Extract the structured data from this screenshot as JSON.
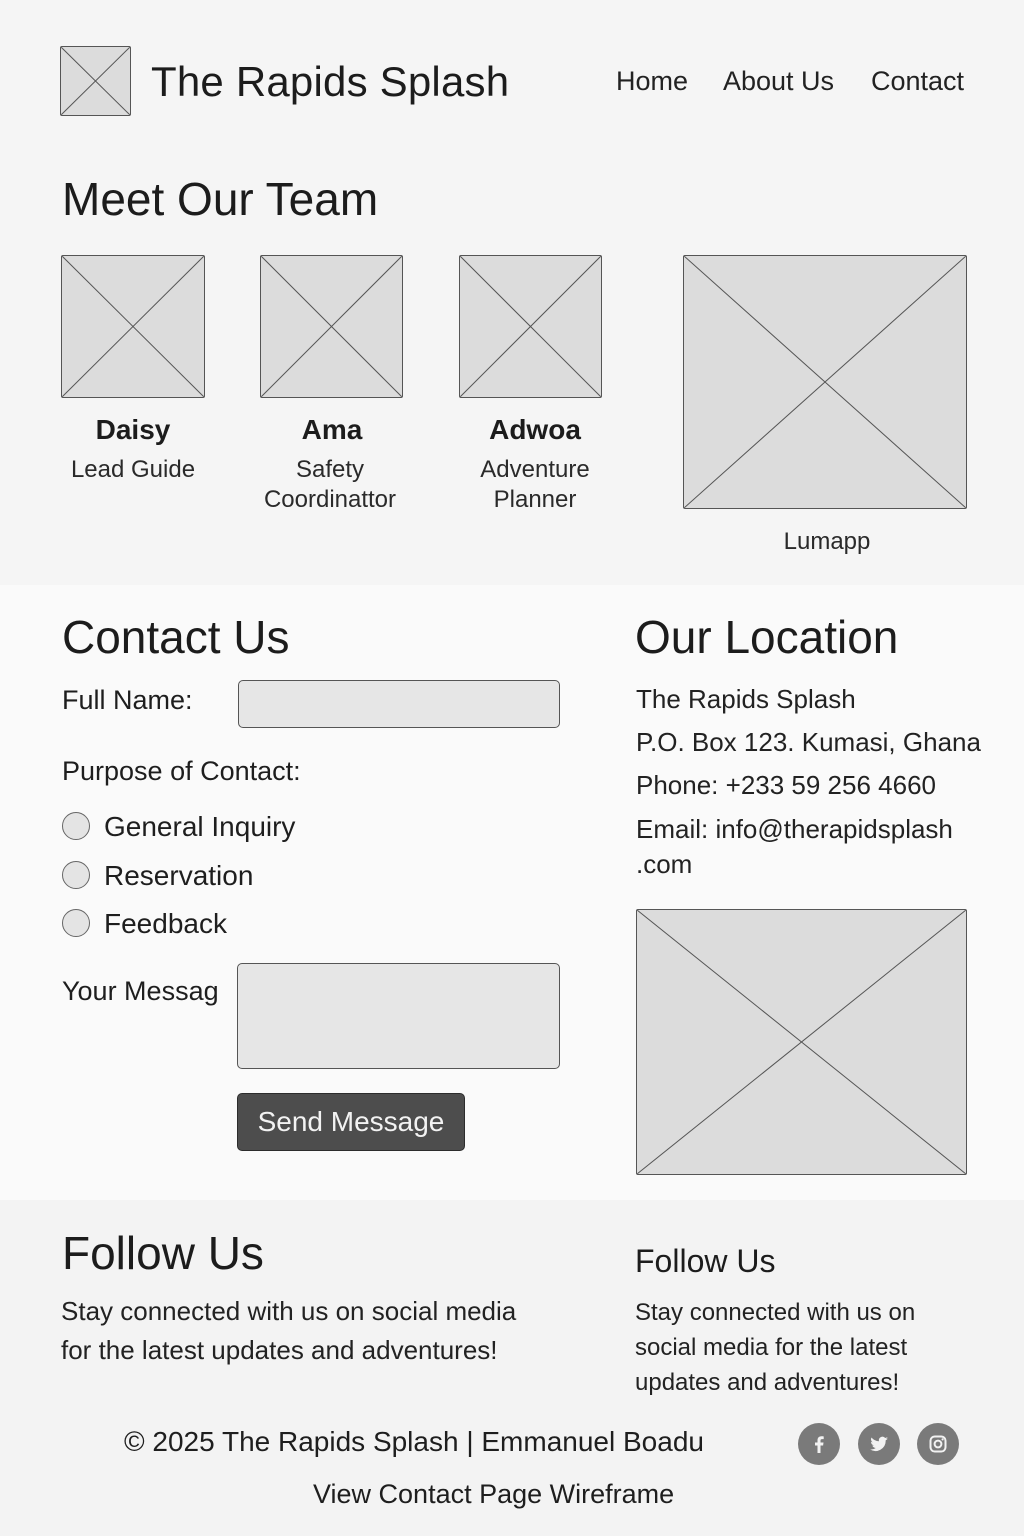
{
  "header": {
    "brand": "The Rapids Splash",
    "nav": [
      "Home",
      "About Us",
      "Contact"
    ]
  },
  "team": {
    "heading": "Meet Our Team",
    "members": [
      {
        "name": "Daisy",
        "role_line1": "Lead Guide",
        "role_line2": ""
      },
      {
        "name": "Ama",
        "role_line1": "Safety",
        "role_line2": "Coordinattor"
      },
      {
        "name": "Adwoa",
        "role_line1": "Adventure",
        "role_line2": "Planner"
      }
    ],
    "feature_caption": "Lumapp"
  },
  "contact": {
    "heading": "Contact Us",
    "full_name_label": "Full Name:",
    "purpose_label": "Purpose of Contact:",
    "options": [
      "General Inquiry",
      "Reservation",
      "Feedback"
    ],
    "message_label": "Your Messag",
    "send_label": "Send Message"
  },
  "location": {
    "heading": "Our Location",
    "lines": [
      "The Rapids Splash",
      "P.O. Box 123. Kumasi, Ghana",
      "Phone: +233 59 256 4660",
      "Email: info@therapidsplash",
      ".com"
    ]
  },
  "follow": {
    "heading": "Follow Us",
    "text_line1": "Stay connected with us on social media",
    "text_line2": "for the latest updates and adventures!",
    "side_heading": "Follow Us",
    "side_line1": "Stay connected with us on",
    "side_line2": "social media for the latest",
    "side_line3": "updates and adventures!"
  },
  "footer": {
    "copyright": "© 2025 The Rapids Splash | Emmanuel Boadu",
    "link": "View Contact Page Wireframe",
    "social_icons": [
      "facebook-icon",
      "twitter-icon",
      "instagram-icon"
    ]
  },
  "colors": {
    "background": "#f5f5f5",
    "placeholder": "#dcdcdc",
    "button": "#4d4d4d",
    "social": "#7a7a7a"
  }
}
